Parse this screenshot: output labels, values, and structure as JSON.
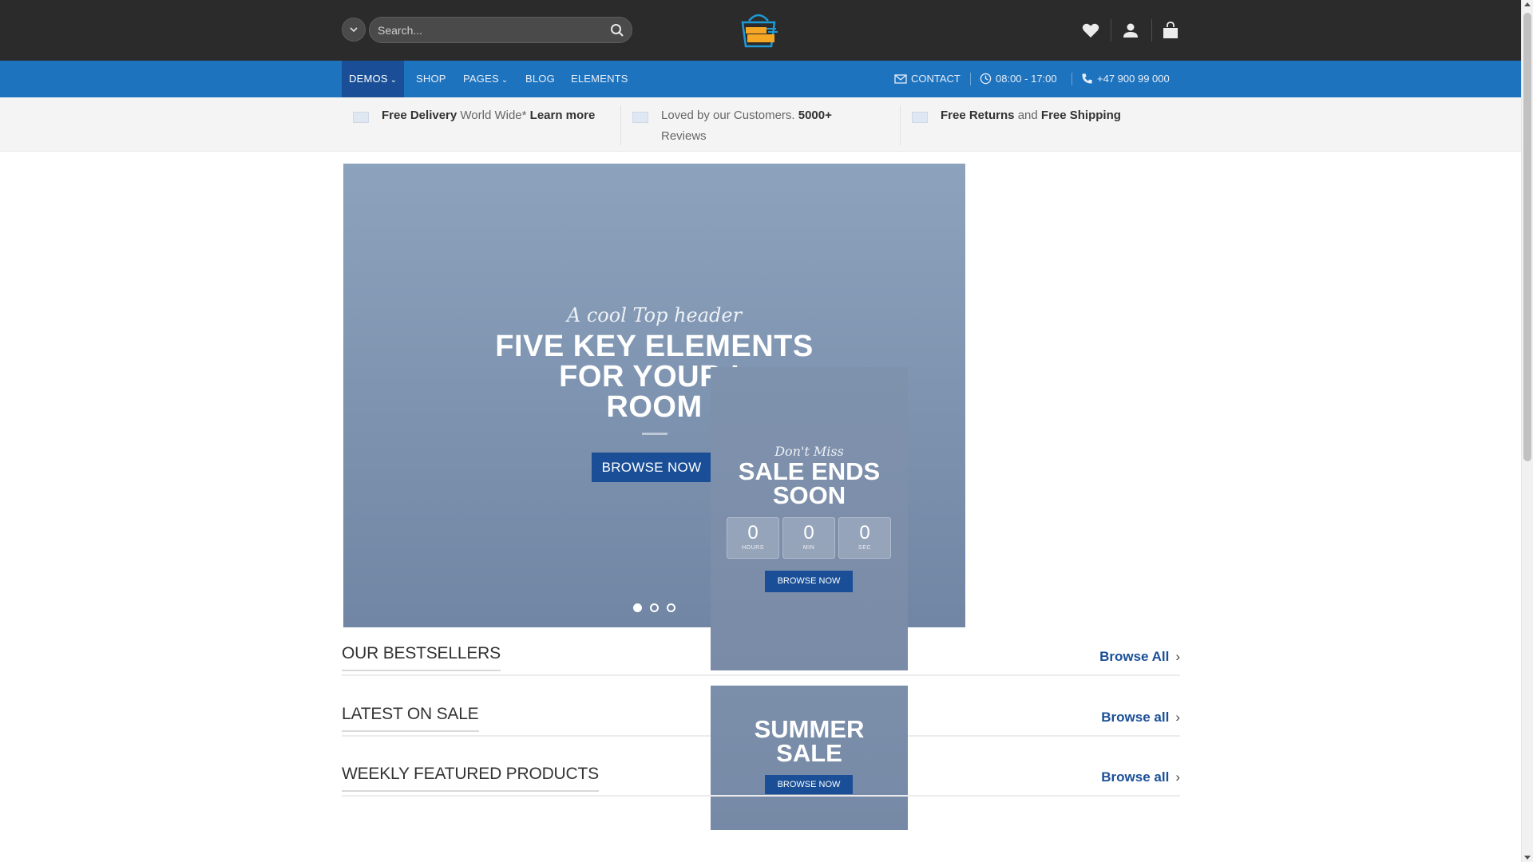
{
  "header": {
    "search_placeholder": "Search...",
    "logo_alt": "Click & Collect"
  },
  "nav": {
    "items": [
      {
        "label": "DEMOS",
        "has_dropdown": true,
        "active": true
      },
      {
        "label": "SHOP",
        "has_dropdown": false
      },
      {
        "label": "PAGES",
        "has_dropdown": true
      },
      {
        "label": "BLOG",
        "has_dropdown": false
      },
      {
        "label": "ELEMENTS",
        "has_dropdown": false
      }
    ],
    "contact": "CONTACT",
    "hours": "08:00 - 17:00",
    "phone": "+47 900 99 000"
  },
  "benefits": [
    {
      "bold": "Free Delivery",
      "text": " World Wide* ",
      "link": "Learn more"
    },
    {
      "text": "Loved by our Customers. ",
      "bold": "5000+",
      "text2": "Reviews"
    },
    {
      "bold": "Free Returns",
      "text": " and ",
      "bold2": "Free Shipping"
    }
  ],
  "slider": {
    "subtitle": "A cool Top header",
    "title_lines": [
      "FIVE KEY ELEMENTS",
      "FOR YOUR L",
      "ROOM"
    ],
    "button": "BROWSE NOW",
    "slide_count": 3,
    "active_slide": 1
  },
  "promo_sale": {
    "subtitle": "Don't Miss",
    "title_lines": [
      "SALE ENDS",
      "SOON"
    ],
    "countdown": [
      {
        "value": "0",
        "label": "HOURS"
      },
      {
        "value": "0",
        "label": "MIN"
      },
      {
        "value": "0",
        "label": "SEC"
      }
    ],
    "button": "BROWSE NOW"
  },
  "promo_summer": {
    "title_lines": [
      "SUMMER",
      "SALE"
    ],
    "button": "BROWSE NOW"
  },
  "sections": [
    {
      "title": "OUR BESTSELLERS",
      "link": "Browse All"
    },
    {
      "title": "LATEST ON SALE",
      "link": "Browse all"
    },
    {
      "title": "WEEKLY FEATURED PRODUCTS",
      "link": "Browse all"
    }
  ],
  "colors": {
    "header_bg": "#2b2b2b",
    "nav_bg": "#1e73be",
    "accent": "#1a4f97"
  }
}
